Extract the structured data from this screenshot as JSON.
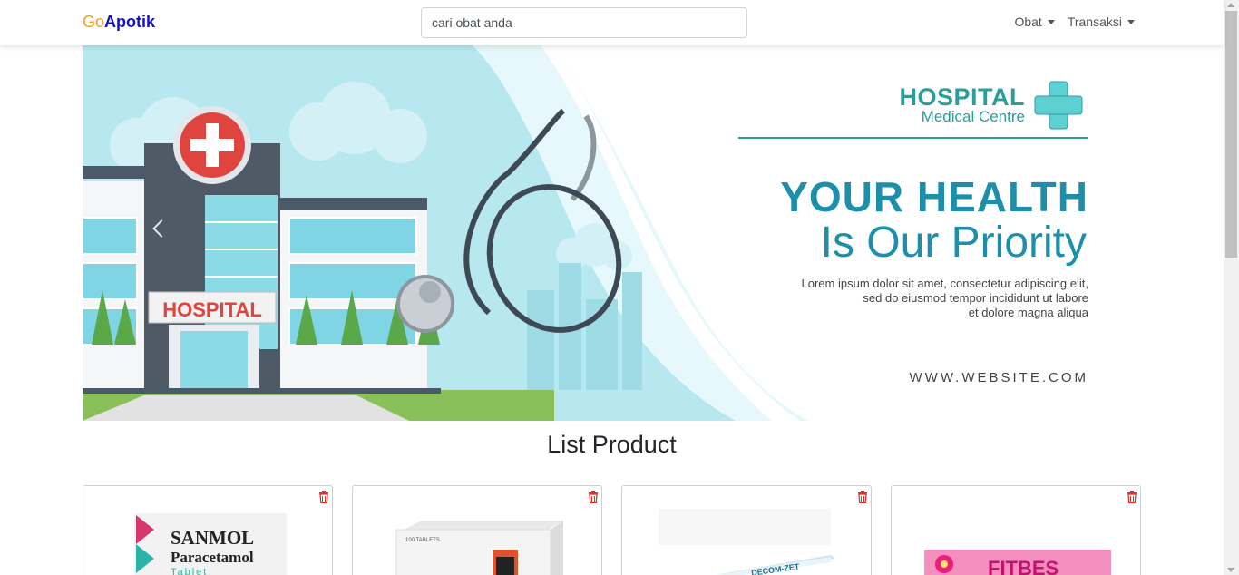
{
  "navbar": {
    "brand_prefix": "Go",
    "brand_suffix": "Apotik",
    "search_placeholder": "cari obat anda",
    "menu": [
      {
        "label": "Obat"
      },
      {
        "label": "Transaksi"
      }
    ]
  },
  "banner": {
    "hospital_title": "HOSPITAL",
    "hospital_subtitle": "Medical Centre",
    "headline_1": "YOUR HEALTH",
    "headline_2": "Is Our Priority",
    "lorem_1": "Lorem ipsum dolor sit amet, consectetur adipiscing elit,",
    "lorem_2": "sed do eiusmod tempor incididunt  ut labore",
    "lorem_3": "et dolore magna aliqua",
    "website": "WWW.WEBSITE.COM",
    "building_sign": "HOSPITAL"
  },
  "products": {
    "title": "List Product",
    "items": [
      {
        "brand": "SANMOL",
        "name": "Paracetamol",
        "form": "Tablet"
      },
      {
        "label": "100 TABLETS"
      },
      {
        "label": "DECOM-ZET"
      },
      {
        "brand": "FITBES"
      }
    ]
  },
  "colors": {
    "brand_go": "#f0a020",
    "brand_apotik": "#1410c8",
    "banner_teal": "#2b9e9b",
    "banner_blue": "#1e8faa",
    "trash_red": "#e0302a"
  }
}
